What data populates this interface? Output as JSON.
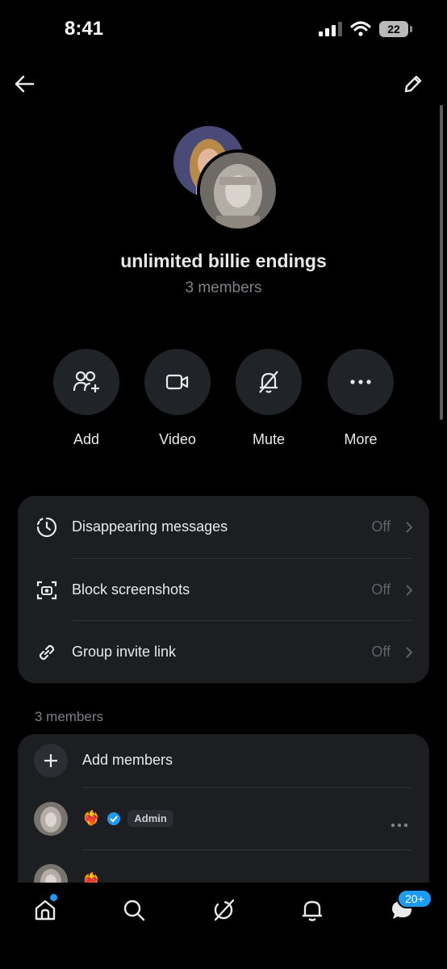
{
  "status_bar": {
    "time": "8:41",
    "battery": "22"
  },
  "group": {
    "name": "unlimited billie endings",
    "member_count": "3 members"
  },
  "actions": [
    {
      "label": "Add",
      "icon": "add-people-icon"
    },
    {
      "label": "Video",
      "icon": "video-icon"
    },
    {
      "label": "Mute",
      "icon": "mute-bell-icon"
    },
    {
      "label": "More",
      "icon": "more-icon"
    }
  ],
  "settings": [
    {
      "label": "Disappearing messages",
      "value": "Off",
      "icon": "timer-icon"
    },
    {
      "label": "Block screenshots",
      "value": "Off",
      "icon": "screenshot-camera-icon"
    },
    {
      "label": "Group invite link",
      "value": "Off",
      "icon": "link-icon"
    }
  ],
  "members_section": {
    "label": "3 members",
    "add_label": "Add members",
    "members": [
      {
        "emoji": "❤️‍🔥",
        "verified": true,
        "badge": "Admin"
      },
      {
        "emoji": "❤️‍🔥"
      }
    ]
  },
  "tabbar": {
    "messages_badge": "20+"
  },
  "colors": {
    "accent": "#1d9bf0",
    "background": "#000000",
    "card": "#1c1e21"
  }
}
